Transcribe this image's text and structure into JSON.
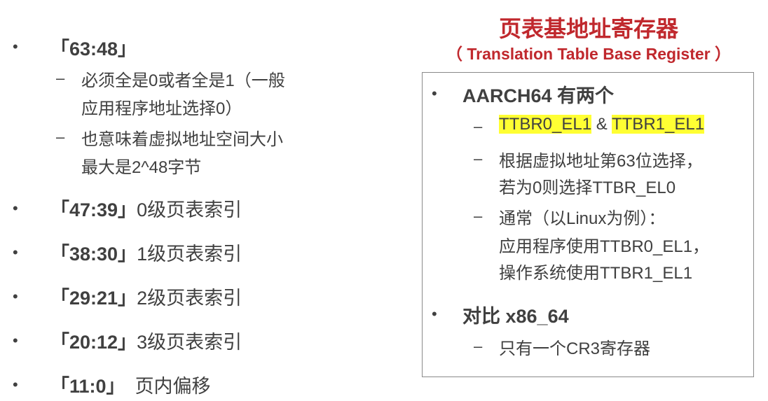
{
  "left": {
    "items": [
      {
        "bullet": "•",
        "range": "「63:48」",
        "text": ""
      },
      {
        "bullet": "•",
        "range": "「47:39」",
        "text": "0级页表索引"
      },
      {
        "bullet": "•",
        "range": "「38:30」",
        "text": "1级页表索引"
      },
      {
        "bullet": "•",
        "range": "「29:21」",
        "text": "2级页表索引"
      },
      {
        "bullet": "•",
        "range": "「20:12」",
        "text": "3级页表索引"
      },
      {
        "bullet": "•",
        "range": "「11:0」",
        "text": "页内偏移"
      }
    ],
    "sub": [
      {
        "dash": "–",
        "line1": "必须全是0或者全是1（一般",
        "line2": "应用程序地址选择0）"
      },
      {
        "dash": "–",
        "line1": "也意味着虚拟地址空间大小",
        "line2": "最大是2^48字节"
      }
    ]
  },
  "right": {
    "title": "页表基地址寄存器",
    "subtitle": "（ Translation Table Base Register ）",
    "items": [
      {
        "bullet": "•",
        "label": "AARCH64 有两个"
      },
      {
        "bullet": "•",
        "label": "对比 x86_64"
      }
    ],
    "sub": {
      "dash": "–",
      "reg0": "TTBR0_EL1",
      "amp": " & ",
      "reg1": "TTBR1_EL1",
      "select_line1": "根据虚拟地址第63位选择，",
      "select_line2": "若为0则选择TTBR_EL0",
      "linux_line1": "通常（以Linux为例）：",
      "linux_line2": "应用程序使用TTBR0_EL1，",
      "linux_line3": "操作系统使用TTBR1_EL1",
      "x86_line": "只有一个CR3寄存器"
    }
  },
  "colors": {
    "title": "#c0282d",
    "highlight": "#ffff33",
    "text": "#404040",
    "border": "#8a8a8a"
  }
}
